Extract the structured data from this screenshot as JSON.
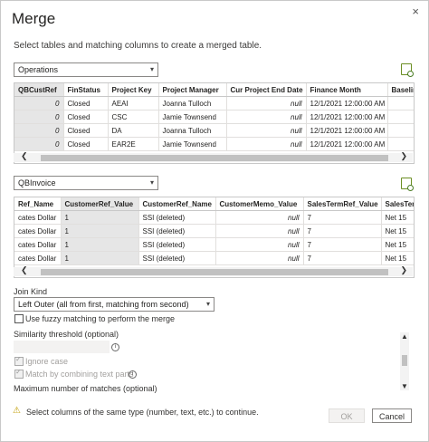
{
  "dialog": {
    "title": "Merge",
    "subtitle": "Select tables and matching columns to create a merged table.",
    "close_glyph": "×"
  },
  "table1": {
    "selected": "Operations",
    "columns": [
      "QBCustRef",
      "FinStatus",
      "Project Key",
      "Project Manager",
      "Cur Project End Date",
      "Finance Month",
      "Baseline"
    ],
    "rows": [
      [
        "0",
        "Closed",
        "AEAI",
        "Joanna Tulloch",
        "null",
        "12/1/2021 12:00:00 AM",
        ""
      ],
      [
        "0",
        "Closed",
        "CSC",
        "Jamie Townsend",
        "null",
        "12/1/2021 12:00:00 AM",
        ""
      ],
      [
        "0",
        "Closed",
        "DA",
        "Joanna Tulloch",
        "null",
        "12/1/2021 12:00:00 AM",
        ""
      ],
      [
        "0",
        "Closed",
        "EAR2E",
        "Jamie Townsend",
        "null",
        "12/1/2021 12:00:00 AM",
        ""
      ]
    ]
  },
  "table2": {
    "selected": "QBInvoice",
    "columns": [
      "Ref_Name",
      "CustomerRef_Value",
      "CustomerRef_Name",
      "CustomerMemo_Value",
      "SalesTermRef_Value",
      "SalesTer"
    ],
    "rows": [
      [
        "cates Dollar",
        "1",
        "SSI (deleted)",
        "null",
        "7",
        "Net 15"
      ],
      [
        "cates Dollar",
        "1",
        "SSI (deleted)",
        "null",
        "7",
        "Net 15"
      ],
      [
        "cates Dollar",
        "1",
        "SSI (deleted)",
        "null",
        "7",
        "Net 15"
      ],
      [
        "cates Dollar",
        "1",
        "SSI (deleted)",
        "null",
        "7",
        "Net 15"
      ]
    ]
  },
  "join": {
    "label": "Join Kind",
    "selected": "Left Outer (all from first, matching from second)"
  },
  "fuzzy": {
    "label": "Use fuzzy matching to perform the merge",
    "checked": false,
    "similarity_label": "Similarity threshold (optional)",
    "ignore_case_label": "Ignore case",
    "combine_label": "Match by combining text parts",
    "max_matches_label": "Maximum number of matches (optional)"
  },
  "warning": {
    "text": "Select columns of the same type (number, text, etc.) to continue."
  },
  "buttons": {
    "ok": "OK",
    "cancel": "Cancel"
  },
  "colors": {
    "accent_warning": "#c19c00",
    "selected_column_bg": "#e6e6e6"
  }
}
